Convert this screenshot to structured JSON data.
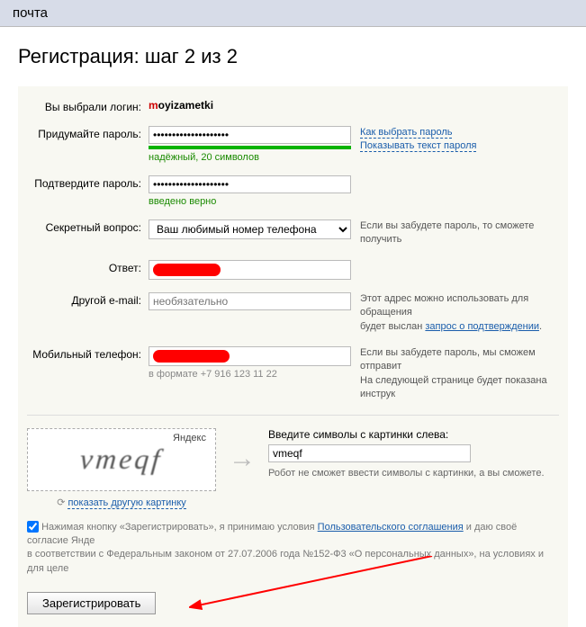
{
  "tab": {
    "mail": "почта"
  },
  "heading": "Регистрация: шаг 2 из 2",
  "labels": {
    "login": "Вы выбрали логин:",
    "password": "Придумайте пароль:",
    "confirm": "Подтвердите пароль:",
    "question": "Секретный вопрос:",
    "answer": "Ответ:",
    "email": "Другой e-mail:",
    "phone": "Мобильный телефон:"
  },
  "login": {
    "first_char": "m",
    "rest": "oyizametki"
  },
  "password": {
    "value": "●●●●●●●●●●●●●●●●●●●●",
    "strength": "надёжный, 20 символов",
    "how_link": "Как выбрать пароль",
    "show_link": "Показывать текст пароля"
  },
  "confirm": {
    "value": "●●●●●●●●●●●●●●●●●●●●",
    "status": "введено верно"
  },
  "question": {
    "selected": "Ваш любимый номер телефона",
    "hint": "Если вы забудете пароль, то сможете получить"
  },
  "email": {
    "placeholder": "необязательно",
    "hint1": "Этот адрес можно использовать для обращения",
    "hint2_a": "будет выслан ",
    "hint2_link": "запрос о подтверждении",
    "hint2_b": "."
  },
  "phone": {
    "format": "в формате +7 916 123 11 22",
    "hint1": "Если вы забудете пароль, мы сможем отправит",
    "hint2": "На следующей странице будет показана инструк"
  },
  "captcha": {
    "label": "Введите символы с картинки слева:",
    "value": "vmeqf",
    "display": "vmeqf",
    "brand": "Яндекс",
    "note": "Робот не сможет ввести символы с картинки, а вы сможете.",
    "refresh": "показать другую картинку"
  },
  "agreement": {
    "text_a": "Нажимая кнопку «Зарегистрировать», я принимаю условия ",
    "link": "Пользовательского соглашения",
    "text_b": " и даю своё согласие Янде",
    "text_c": "в соответствии с Федеральным законом от 27.07.2006 года №152-Ф3 «О персональных данных», на условиях и для целе"
  },
  "submit": "Зарегистрировать"
}
